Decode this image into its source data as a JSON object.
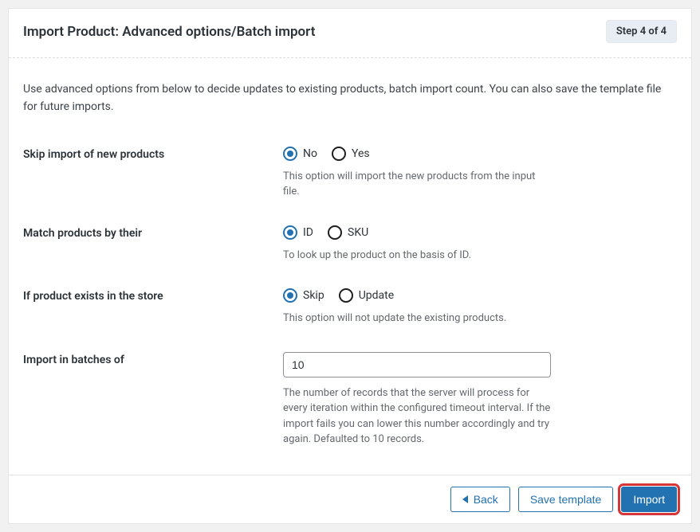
{
  "header": {
    "title": "Import Product: Advanced options/Batch import",
    "step_label": "Step 4 of 4"
  },
  "intro": "Use advanced options from below to decide updates to existing products, batch import count. You can also save the template file for future imports.",
  "fields": {
    "skip_new": {
      "label": "Skip import of new products",
      "option_no": "No",
      "option_yes": "Yes",
      "help": "This option will import the new products from the input file."
    },
    "match_by": {
      "label": "Match products by their",
      "option_id": "ID",
      "option_sku": "SKU",
      "help": "To look up the product on the basis of ID."
    },
    "if_exists": {
      "label": "If product exists in the store",
      "option_skip": "Skip",
      "option_update": "Update",
      "help": "This option will not update the existing products."
    },
    "batch": {
      "label": "Import in batches of",
      "value": "10",
      "help": "The number of records that the server will process for every iteration within the configured timeout interval. If the import fails you can lower this number accordingly and try again. Defaulted to 10 records."
    }
  },
  "footer": {
    "back": "Back",
    "save_template": "Save template",
    "import": "Import"
  }
}
